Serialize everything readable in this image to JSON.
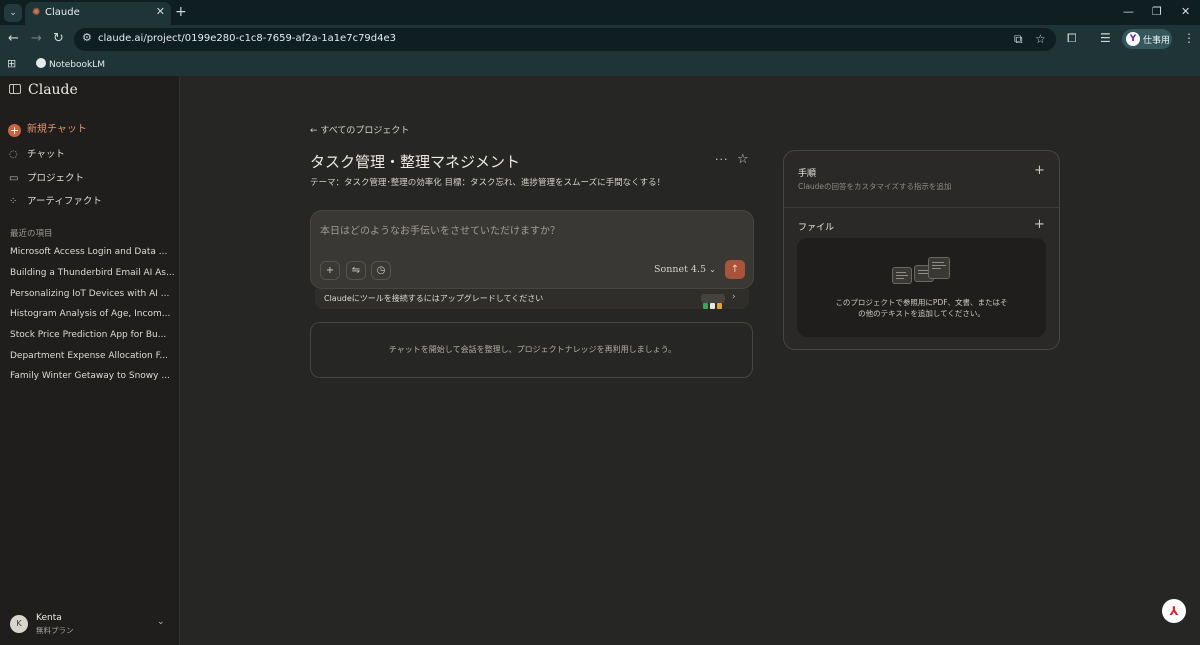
{
  "browser": {
    "tab_title": "Claude",
    "tab_close": "✕",
    "new_tab": "+",
    "url": "claude.ai/project/0199e280-c1c8-7659-af2a-1a1e7c79d4e3",
    "profile_initial": "Y",
    "profile_label": "仕事用",
    "bookmark": "NotebookLM",
    "window_controls": [
      "—",
      "❐",
      "✕"
    ]
  },
  "sidebar": {
    "logo": "Claude",
    "new_chat": "新規チャット",
    "nav": [
      {
        "label": "チャット",
        "icon": "chat-bubble-icon"
      },
      {
        "label": "プロジェクト",
        "icon": "folder-icon"
      },
      {
        "label": "アーティファクト",
        "icon": "artifacts-icon"
      }
    ],
    "recent_heading": "最近の項目",
    "recent": [
      "Microsoft Access Login and Data ...",
      "Building a Thunderbird Email AI As...",
      "Personalizing IoT Devices with AI ...",
      "Histogram Analysis of Age, Incom...",
      "Stock Price Prediction App for Bu...",
      "Department Expense Allocation F...",
      "Family Winter Getaway to Snowy ..."
    ],
    "user": {
      "initial": "K",
      "name": "Kenta",
      "plan": "無料プラン"
    }
  },
  "project": {
    "back_link": "すべてのプロジェクト",
    "title": "タスク管理・整理マネジメント",
    "description": "テーマ：タスク管理･整理の効率化 目標：タスク忘れ、進捗管理をスムーズに手間なくする！",
    "composer_placeholder": "本日はどのようなお手伝いをさせていただけますか？",
    "model": "Sonnet 4.5",
    "tools_banner": "Claudeにツールを接続するにはアップグレードしてください",
    "empty_state": "チャットを開始して会話を整理し、プロジェクトナレッジを再利用しましょう。"
  },
  "panel": {
    "instructions_title": "手順",
    "instructions_sub": "Claudeの回答をカスタマイズする指示を追加",
    "files_title": "ファイル",
    "files_text_1": "このプロジェクトで参照用にPDF、文書、またはそ",
    "files_text_2": "の他のテキストを追加してください。"
  },
  "colors": {
    "accent": "#c96442",
    "send_button": "#a8533a",
    "background": "#262624",
    "sidebar": "#1f1e1d"
  }
}
